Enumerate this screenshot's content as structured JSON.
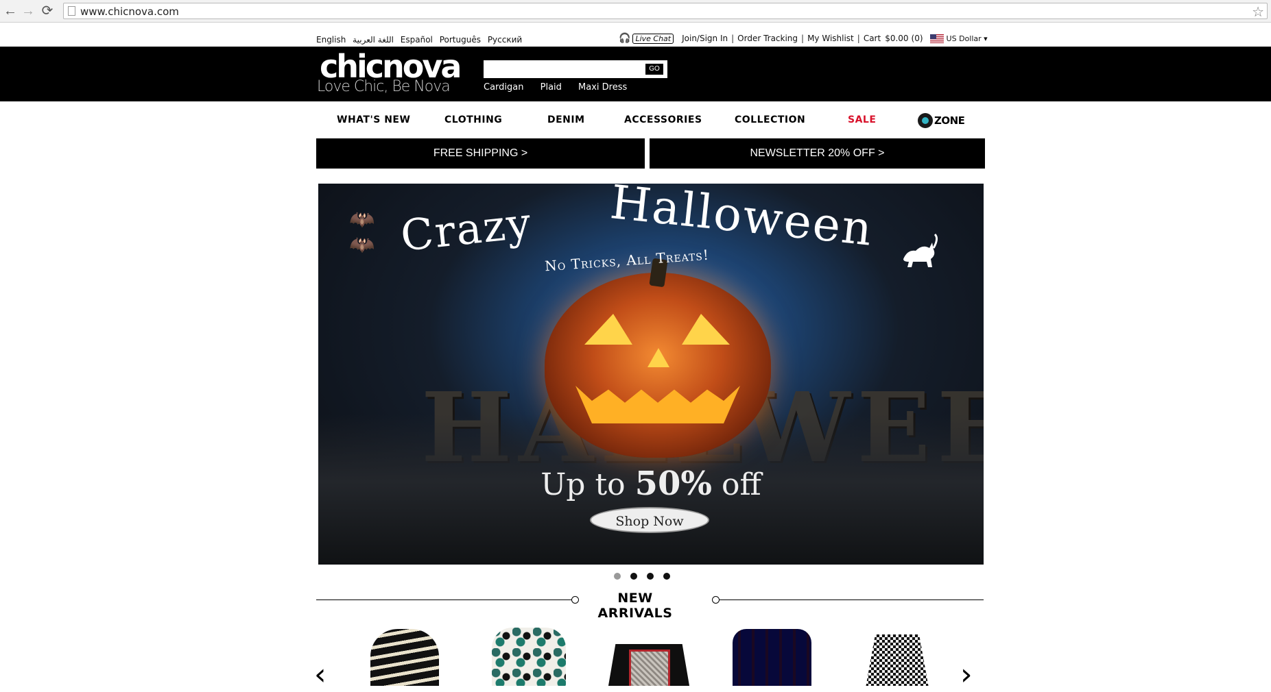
{
  "browser": {
    "url": "www.chicnova.com",
    "back_icon": "←",
    "forward_icon": "→",
    "reload_icon": "⟳",
    "star_icon": "☆"
  },
  "utility": {
    "languages": [
      "English",
      "اللغة العربية",
      "Español",
      "Português",
      "Русский"
    ],
    "live_chat": "Live Chat",
    "join_sign_in": "Join/Sign In",
    "order_tracking": "Order Tracking",
    "wishlist": "My Wishlist",
    "cart_label": "Cart",
    "cart_total": "$0.00",
    "cart_count": "(0)",
    "currency": "US Dollar ▾"
  },
  "header": {
    "logo": "chicnova",
    "tagline": "Love Chic, Be Nova",
    "search_placeholder": "",
    "go_label": "GO",
    "hot_searches": [
      "Cardigan",
      "Plaid",
      "Maxi Dress"
    ]
  },
  "nav": {
    "items": [
      "WHAT'S NEW",
      "CLOTHING",
      "DENIM",
      "ACCESSORIES",
      "COLLECTION",
      "SALE"
    ],
    "czone": "ZONE",
    "sale_color": "#d8112a"
  },
  "promos": {
    "shipping": "FREE SHIPPING   >",
    "newsletter": "NEWSLETTER 20% OFF   >"
  },
  "banner": {
    "title_part1": "Crazy",
    "title_part2": "Halloween",
    "subtitle": "No Tricks, All Treats!",
    "offer_prefix": "Up to ",
    "offer_value": "50%",
    "offer_suffix": " off",
    "cta": "Shop Now",
    "background_letters": "HALLWEE"
  },
  "carousel": {
    "dot_count": 4,
    "active_index": 0
  },
  "new_arrivals": {
    "title": "NEW ARRIVALS",
    "prev_icon": "‹",
    "next_icon": "›"
  }
}
